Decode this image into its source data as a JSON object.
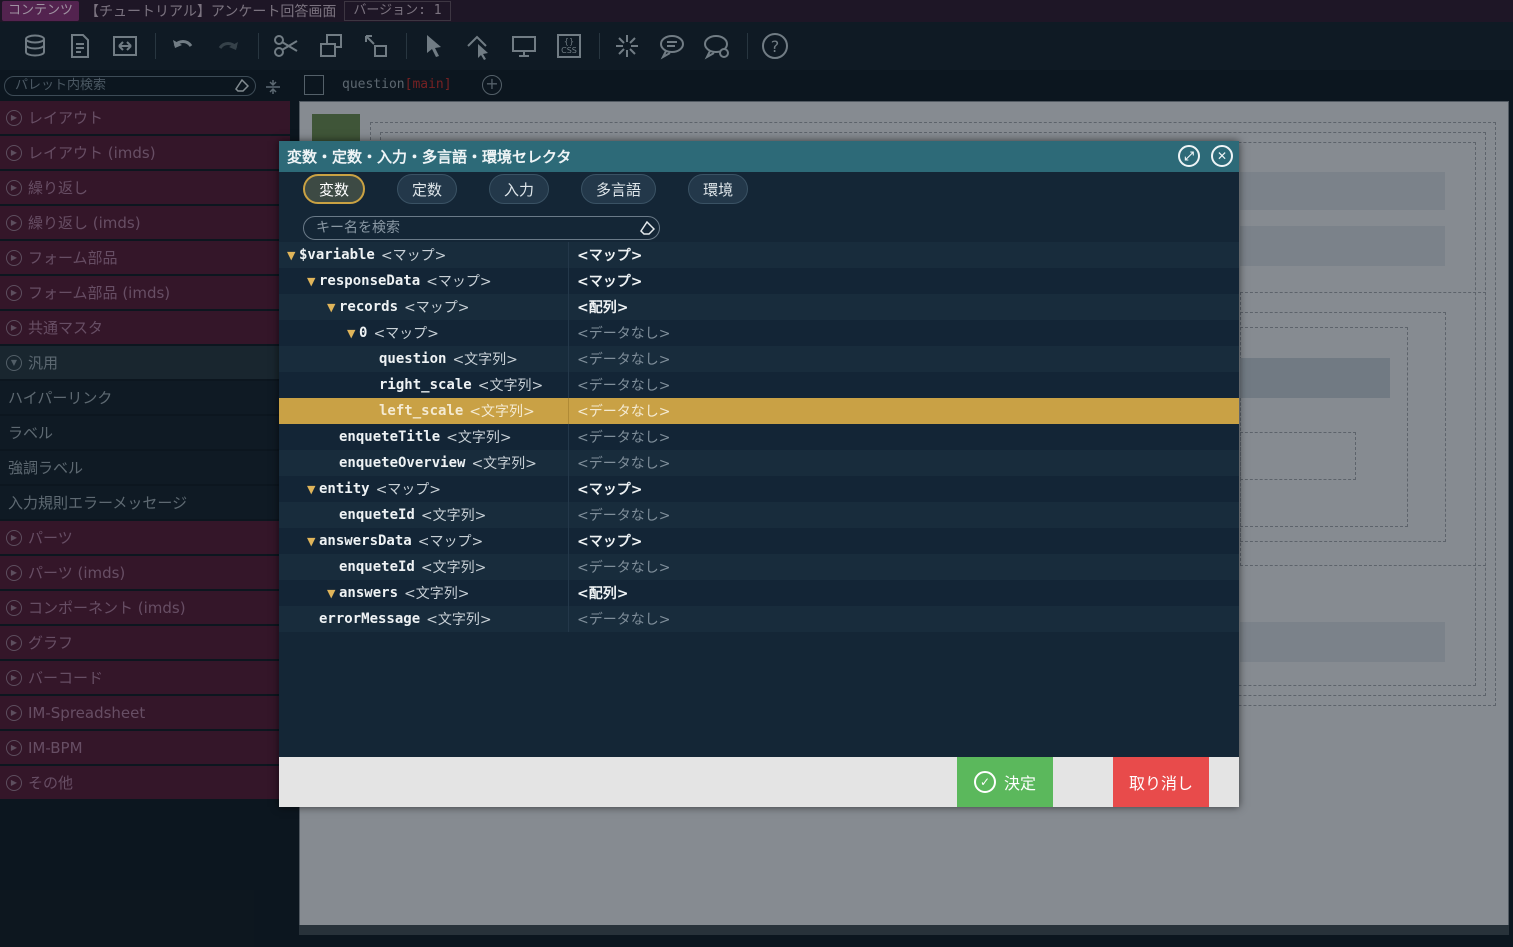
{
  "titlebar": {
    "badge": "コンテンツ",
    "title": "【チュートリアル】アンケート回答画面",
    "version": "バージョン: 1"
  },
  "toolbar": {
    "icons": [
      "database-icon",
      "new-file-icon",
      "swap-icon",
      "undo-icon",
      "redo-icon",
      "cut-icon",
      "copy-icon",
      "move-icon",
      "select-icon",
      "target-icon",
      "monitor-icon",
      "css-icon",
      "spark-icon",
      "comment-icon",
      "comment-settings-icon",
      "help-icon"
    ]
  },
  "palette": {
    "search_placeholder": "パレット内検索",
    "items": [
      {
        "label": "レイアウト",
        "kind": "cat"
      },
      {
        "label": "レイアウト (imds)",
        "kind": "cat"
      },
      {
        "label": "繰り返し",
        "kind": "cat"
      },
      {
        "label": "繰り返し (imds)",
        "kind": "cat"
      },
      {
        "label": "フォーム部品",
        "kind": "cat"
      },
      {
        "label": "フォーム部品 (imds)",
        "kind": "cat"
      },
      {
        "label": "共通マスタ",
        "kind": "cat"
      },
      {
        "label": "汎用",
        "kind": "open"
      },
      {
        "label": "ハイパーリンク",
        "kind": "plain"
      },
      {
        "label": "ラベル",
        "kind": "plain"
      },
      {
        "label": "強調ラベル",
        "kind": "plain"
      },
      {
        "label": "入力規則エラーメッセージ",
        "kind": "plain"
      },
      {
        "label": "パーツ",
        "kind": "cat"
      },
      {
        "label": "パーツ (imds)",
        "kind": "cat"
      },
      {
        "label": "コンポーネント (imds)",
        "kind": "cat"
      },
      {
        "label": "グラフ",
        "kind": "cat"
      },
      {
        "label": "バーコード",
        "kind": "cat"
      },
      {
        "label": "IM-Spreadsheet",
        "kind": "cat"
      },
      {
        "label": "IM-BPM",
        "kind": "cat"
      },
      {
        "label": "その他",
        "kind": "cat"
      }
    ]
  },
  "editor": {
    "tab_name": "question",
    "tab_scope": "[main]"
  },
  "dialog": {
    "title": "変数・定数・入力・多言語・環境セレクタ",
    "tabs": [
      {
        "label": "変数",
        "active": true
      },
      {
        "label": "定数",
        "active": false
      },
      {
        "label": "入力",
        "active": false
      },
      {
        "label": "多言語",
        "active": false
      },
      {
        "label": "環境",
        "active": false
      }
    ],
    "key_search_placeholder": "キー名を検索",
    "tree": [
      {
        "depth": 0,
        "arrow": "▼",
        "name": "$variable",
        "type": "<マップ>",
        "value": "<マップ>",
        "style": "strong"
      },
      {
        "depth": 1,
        "arrow": "▼",
        "name": "responseData",
        "type": "<マップ>",
        "value": "<マップ>",
        "style": "strong"
      },
      {
        "depth": 2,
        "arrow": "▼",
        "name": "records",
        "type": "<マップ>",
        "value": "<配列>",
        "style": "strong"
      },
      {
        "depth": 3,
        "arrow": "▼",
        "name": "0",
        "type": "<マップ>",
        "value": "<データなし>",
        "style": "nodata"
      },
      {
        "depth": 4,
        "arrow": "",
        "name": "question",
        "type": "<文字列>",
        "value": "<データなし>",
        "style": "nodata"
      },
      {
        "depth": 4,
        "arrow": "",
        "name": "right_scale",
        "type": "<文字列>",
        "value": "<データなし>",
        "style": "nodata"
      },
      {
        "depth": 4,
        "arrow": "",
        "name": "left_scale",
        "type": "<文字列>",
        "value": "<データなし>",
        "style": "nodata",
        "selected": true
      },
      {
        "depth": 2,
        "arrow": "",
        "name": "enqueteTitle",
        "type": "<文字列>",
        "value": "<データなし>",
        "style": "nodata"
      },
      {
        "depth": 2,
        "arrow": "",
        "name": "enqueteOverview",
        "type": "<文字列>",
        "value": "<データなし>",
        "style": "nodata"
      },
      {
        "depth": 1,
        "arrow": "▼",
        "name": "entity",
        "type": "<マップ>",
        "value": "<マップ>",
        "style": "strong"
      },
      {
        "depth": 2,
        "arrow": "",
        "name": "enqueteId",
        "type": "<文字列>",
        "value": "<データなし>",
        "style": "nodata"
      },
      {
        "depth": 1,
        "arrow": "▼",
        "name": "answersData",
        "type": "<マップ>",
        "value": "<マップ>",
        "style": "strong"
      },
      {
        "depth": 2,
        "arrow": "",
        "name": "enqueteId",
        "type": "<文字列>",
        "value": "<データなし>",
        "style": "nodata"
      },
      {
        "depth": 2,
        "arrow": "▼",
        "name": "answers",
        "type": "<文字列>",
        "value": "<配列>",
        "style": "strong"
      },
      {
        "depth": 1,
        "arrow": "",
        "name": "errorMessage",
        "type": "<文字列>",
        "value": "<データなし>",
        "style": "nodata"
      }
    ],
    "ok_label": "決定",
    "cancel_label": "取り消し"
  }
}
